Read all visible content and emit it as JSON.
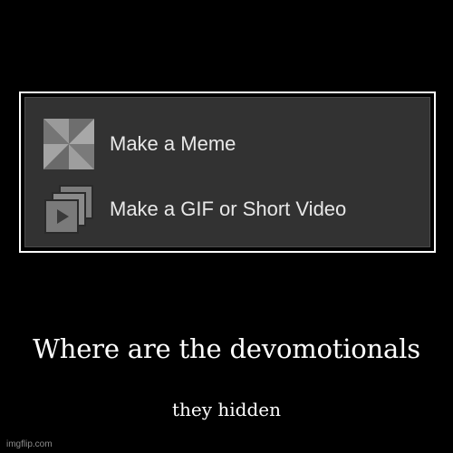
{
  "menu": {
    "items": [
      {
        "label": "Make a Meme",
        "icon": "pinwheel-icon"
      },
      {
        "label": "Make a GIF or Short Video",
        "icon": "stacked-video-icon"
      }
    ]
  },
  "caption": {
    "title": "Where are the devomotionals",
    "subtitle": "they hidden"
  },
  "watermark": "imgflip.com",
  "colors": {
    "background": "#000000",
    "frame_border": "#ffffff",
    "panel": "#323232",
    "icon_gray": "#8a8a8a",
    "menu_text": "#e8e8e8"
  }
}
